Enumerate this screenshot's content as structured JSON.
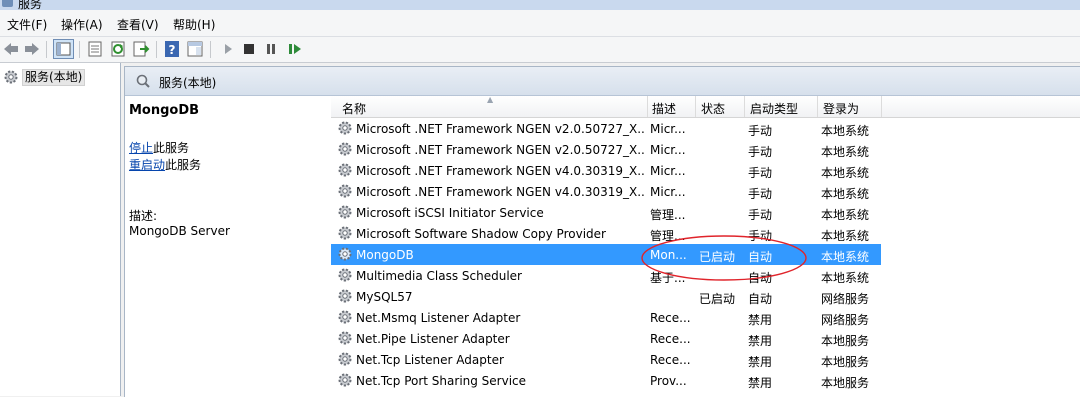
{
  "window": {
    "title": "服务"
  },
  "menu": [
    "文件(F)",
    "操作(A)",
    "查看(V)",
    "帮助(H)"
  ],
  "tree": {
    "root_label": "服务(本地)"
  },
  "content_header": {
    "label": "服务(本地)"
  },
  "extended": {
    "service_name": "MongoDB",
    "stop_link": "停止",
    "stop_suffix": "此服务",
    "restart_link": "重启动",
    "restart_suffix": "此服务",
    "desc_label": "描述:",
    "desc_value": "MongoDB Server"
  },
  "columns": {
    "name": "名称",
    "desc": "描述",
    "status": "状态",
    "startup": "启动类型",
    "logon": "登录为"
  },
  "services": [
    {
      "name": "Microsoft .NET Framework NGEN v2.0.50727_X...",
      "desc": "Micr...",
      "status": "",
      "startup": "手动",
      "logon": "本地系统"
    },
    {
      "name": "Microsoft .NET Framework NGEN v2.0.50727_X...",
      "desc": "Micr...",
      "status": "",
      "startup": "手动",
      "logon": "本地系统"
    },
    {
      "name": "Microsoft .NET Framework NGEN v4.0.30319_X...",
      "desc": "Micr...",
      "status": "",
      "startup": "手动",
      "logon": "本地系统"
    },
    {
      "name": "Microsoft .NET Framework NGEN v4.0.30319_X...",
      "desc": "Micr...",
      "status": "",
      "startup": "手动",
      "logon": "本地系统"
    },
    {
      "name": "Microsoft iSCSI Initiator Service",
      "desc": "管理...",
      "status": "",
      "startup": "手动",
      "logon": "本地系统"
    },
    {
      "name": "Microsoft Software Shadow Copy Provider",
      "desc": "管理...",
      "status": "",
      "startup": "手动",
      "logon": "本地系统"
    },
    {
      "name": "MongoDB",
      "desc": "Mon...",
      "status": "已启动",
      "startup": "自动",
      "logon": "本地系统",
      "selected": true
    },
    {
      "name": "Multimedia Class Scheduler",
      "desc": "基于...",
      "status": "",
      "startup": "自动",
      "logon": "本地系统"
    },
    {
      "name": "MySQL57",
      "desc": "",
      "status": "已启动",
      "startup": "自动",
      "logon": "网络服务"
    },
    {
      "name": "Net.Msmq Listener Adapter",
      "desc": "Rece...",
      "status": "",
      "startup": "禁用",
      "logon": "网络服务"
    },
    {
      "name": "Net.Pipe Listener Adapter",
      "desc": "Rece...",
      "status": "",
      "startup": "禁用",
      "logon": "本地服务"
    },
    {
      "name": "Net.Tcp Listener Adapter",
      "desc": "Rece...",
      "status": "",
      "startup": "禁用",
      "logon": "本地服务"
    },
    {
      "name": "Net.Tcp Port Sharing Service",
      "desc": "Prov...",
      "status": "",
      "startup": "禁用",
      "logon": "本地服务"
    }
  ],
  "colors": {
    "selection": "#3399ff",
    "annotation": "#e0242b",
    "link": "#0645ad"
  }
}
